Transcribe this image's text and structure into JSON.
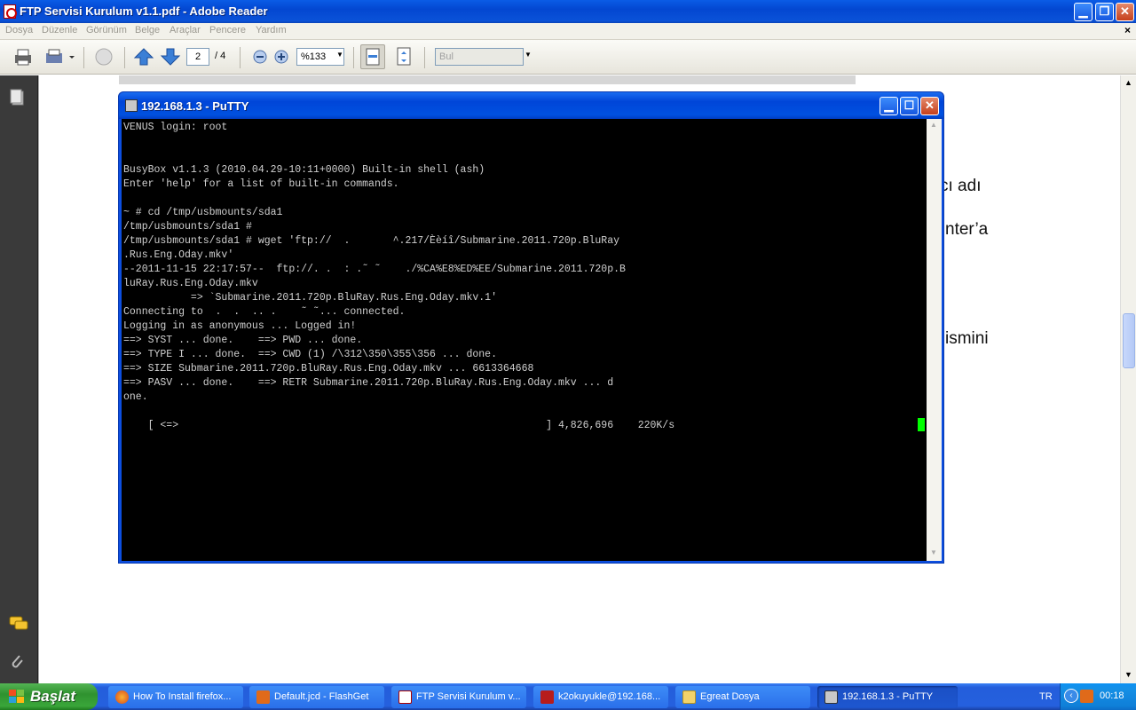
{
  "reader": {
    "title": "FTP Servisi Kurulum v1.1.pdf - Adobe Reader",
    "menu": [
      "Dosya",
      "Düzenle",
      "Görünüm",
      "Belge",
      "Araçlar",
      "Pencere",
      "Yardım"
    ],
    "menu_close": "×",
    "page_current": "2",
    "page_total": "/ 4",
    "zoom": "%133",
    "find_placeholder": "Bul"
  },
  "doc": {
    "fragments": [
      "cı  adı",
      "nter’a",
      "ismini"
    ]
  },
  "putty": {
    "title": "192.168.1.3 - PuTTY",
    "lines": [
      "VENUS login: root",
      "",
      "",
      "BusyBox v1.1.3 (2010.04.29-10:11+0000) Built-in shell (ash)",
      "Enter 'help' for a list of built-in commands.",
      "",
      "~ # cd /tmp/usbmounts/sda1",
      "/tmp/usbmounts/sda1 #",
      "/tmp/usbmounts/sda1 # wget 'ftp://  .       ^.217/Èèíî/Submarine.2011.720p.BluRay",
      ".Rus.Eng.Oday.mkv'",
      "--2011-11-15 22:17:57--  ftp://. .  : .˜ ˜    ./%CA%E8%ED%EE/Submarine.2011.720p.B",
      "luRay.Rus.Eng.Oday.mkv",
      "           => `Submarine.2011.720p.BluRay.Rus.Eng.Oday.mkv.1'",
      "Connecting to  .  .  .. .    ˜ ˜... connected.",
      "Logging in as anonymous ... Logged in!",
      "==> SYST ... done.    ==> PWD ... done.",
      "==> TYPE I ... done.  ==> CWD (1) /\\312\\350\\355\\356 ... done.",
      "==> SIZE Submarine.2011.720p.BluRay.Rus.Eng.Oday.mkv ... 6613364668",
      "==> PASV ... done.    ==> RETR Submarine.2011.720p.BluRay.Rus.Eng.Oday.mkv ... d",
      "one.",
      "",
      "    [ <=>                                                            ] 4,826,696    220K/s"
    ]
  },
  "taskbar": {
    "start_label": "Başlat",
    "tasks": [
      {
        "label": "How To Install firefox...",
        "icon": "firefox-icon"
      },
      {
        "label": "Default.jcd - FlashGet",
        "icon": "flashget-icon"
      },
      {
        "label": "FTP Servisi Kurulum v...",
        "icon": "pdf-icon"
      },
      {
        "label": "k2okuyukle@192.168...",
        "icon": "filezilla-icon"
      },
      {
        "label": "Egreat Dosya",
        "icon": "folder-icon"
      },
      {
        "label": "192.168.1.3 - PuTTY",
        "icon": "putty-icon"
      }
    ],
    "lang": "TR",
    "clock": "00:18"
  }
}
